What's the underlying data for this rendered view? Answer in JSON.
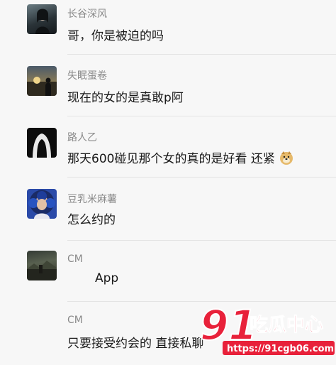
{
  "comments": [
    {
      "name": "长谷深风",
      "text": "哥，你是被迫的吗",
      "avatar_icon": "dark-portrait-avatar"
    },
    {
      "name": "失眠蛋卷",
      "text": "现在的女的是真敢p阿",
      "avatar_icon": "sunset-silhouette-avatar"
    },
    {
      "name": "路人乙",
      "text": "那天600碰见那个女的真的是好看   还紧",
      "emoji": "doge-emoji",
      "avatar_icon": "hooded-figure-avatar"
    },
    {
      "name": "豆乳米麻薯",
      "text": "怎么约的",
      "avatar_icon": "blue-hair-girl-avatar"
    },
    {
      "name": "CM",
      "text": "App",
      "avatar_icon": "dusk-landscape-avatar"
    },
    {
      "name": "CM",
      "text": "只要接受约会的 直接私聊 ",
      "avatar_icon": ""
    }
  ],
  "watermark": {
    "number": "91",
    "brand": "吃瓜中心",
    "url": "https://91cgb06.com"
  },
  "colors": {
    "background": "#f7f7f7",
    "name": "#8a8a8a",
    "text": "#191919",
    "watermark_red": "#e8213a"
  }
}
